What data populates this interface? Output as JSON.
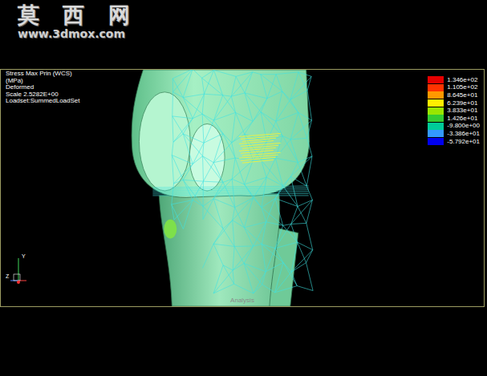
{
  "watermark": {
    "title": "莫 西 网",
    "url": "www.3dmox.com"
  },
  "viewport": {
    "info": [
      "Stress Max Prin (WCS)",
      "(MPa)",
      "Deformed",
      "Scale  2.5282E+00",
      "Loadset:SummedLoadSet"
    ],
    "footer": "Analysis"
  },
  "legend": [
    {
      "value": "1.346e+02",
      "color": "#e60000"
    },
    {
      "value": "1.105e+02",
      "color": "#ff3300"
    },
    {
      "value": "8.645e+01",
      "color": "#ff9900"
    },
    {
      "value": "6.239e+01",
      "color": "#ffee00"
    },
    {
      "value": "3.833e+01",
      "color": "#99e600"
    },
    {
      "value": "1.426e+01",
      "color": "#33cc33"
    },
    {
      "value": "-9.800e+00",
      "color": "#00cc99"
    },
    {
      "value": "-3.386e+01",
      "color": "#3399ff"
    },
    {
      "value": "-5.792e+01",
      "color": "#0000ee"
    }
  ],
  "triad": {
    "y": "Y",
    "z": "Z"
  }
}
